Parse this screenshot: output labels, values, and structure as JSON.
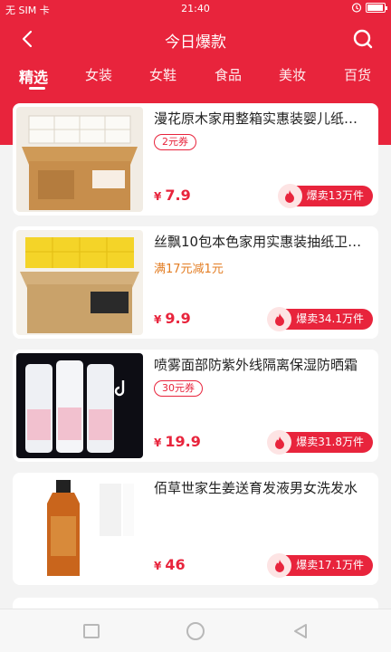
{
  "status": {
    "left": "无 SIM 卡",
    "time": "21:40"
  },
  "header": {
    "title": "今日爆款"
  },
  "tabs": [
    {
      "label": "精选",
      "active": true
    },
    {
      "label": "女装"
    },
    {
      "label": "女鞋"
    },
    {
      "label": "食品"
    },
    {
      "label": "美妆"
    },
    {
      "label": "百货"
    }
  ],
  "products": [
    {
      "title": "漫花原木家用整箱实惠装婴儿纸巾抽纸",
      "tag": "2元券",
      "tag_type": "coupon",
      "price": "7.9",
      "sold": "爆卖13万件"
    },
    {
      "title": "丝飘10包本色家用实惠装抽纸卫生纸",
      "tag": "满17元减1元",
      "tag_type": "promo",
      "price": "9.9",
      "sold": "爆卖34.1万件"
    },
    {
      "title": "喷雾面部防紫外线隔离保湿防晒霜",
      "tag": "30元券",
      "tag_type": "coupon",
      "price": "19.9",
      "sold": "爆卖31.8万件"
    },
    {
      "title": "佰草世家生姜送育发液男女洗发水",
      "tag": "",
      "tag_type": "none",
      "price": "46",
      "sold": "爆卖17.1万件"
    }
  ],
  "currency": "¥",
  "colors": {
    "brand_red": "#e8243c",
    "promo_orange": "#e37d23"
  }
}
